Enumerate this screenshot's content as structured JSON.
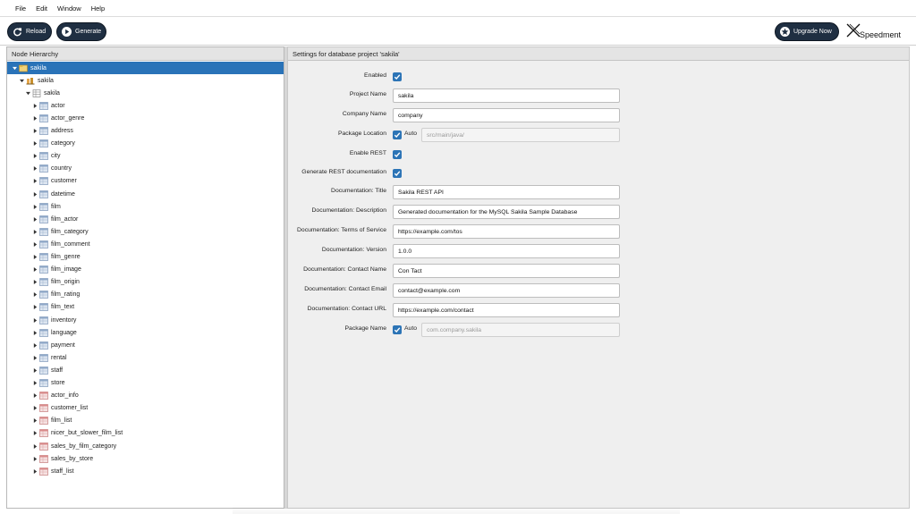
{
  "menu": [
    "File",
    "Edit",
    "Window",
    "Help"
  ],
  "toolbar": {
    "reload_label": "Reload",
    "generate_label": "Generate",
    "upgrade_label": "Upgrade Now",
    "logo_text": "Speedment"
  },
  "tree": {
    "header": "Node Hierarchy",
    "root": "sakila",
    "dbms": "sakila",
    "schema": "sakila",
    "tables": [
      "actor",
      "actor_genre",
      "address",
      "category",
      "city",
      "country",
      "customer",
      "datetime",
      "film",
      "film_actor",
      "film_category",
      "film_comment",
      "film_genre",
      "film_image",
      "film_origin",
      "film_rating",
      "film_text",
      "inventory",
      "language",
      "payment",
      "rental",
      "staff",
      "store"
    ],
    "views": [
      "actor_info",
      "customer_list",
      "film_list",
      "nicer_but_slower_film_list",
      "sales_by_film_category",
      "sales_by_store",
      "staff_list"
    ]
  },
  "settings": {
    "header": "Settings for database project 'sakila'",
    "enabled_label": "Enabled",
    "project_name_label": "Project Name",
    "project_name_value": "sakila",
    "company_name_label": "Company Name",
    "company_name_value": "company",
    "package_location_label": "Package Location",
    "package_location_auto": "Auto",
    "package_location_value": "src/main/java/",
    "enable_rest_label": "Enable REST",
    "generate_rest_doc_label": "Generate REST documentation",
    "doc_title_label": "Documentation: Title",
    "doc_title_value": "Sakila REST API",
    "doc_description_label": "Documentation: Description",
    "doc_description_value": "Generated documentation for the MySQL Sakila Sample Database",
    "doc_tos_label": "Documentation: Terms of Service",
    "doc_tos_value": "https://example.com/tos",
    "doc_version_label": "Documentation: Version",
    "doc_version_value": "1.0.0",
    "doc_contact_name_label": "Documentation: Contact Name",
    "doc_contact_name_value": "Con Tact",
    "doc_contact_email_label": "Documentation: Contact Email",
    "doc_contact_email_value": "contact@example.com",
    "doc_contact_url_label": "Documentation: Contact URL",
    "doc_contact_url_value": "https://example.com/contact",
    "package_name_label": "Package Name",
    "package_name_auto": "Auto",
    "package_name_value": "com.company.sakila"
  },
  "colors": {
    "accent": "#2a73b8",
    "pill": "#1f2f42",
    "table_icon": "#8fa8c8",
    "view_icon": "#d98b8b"
  }
}
